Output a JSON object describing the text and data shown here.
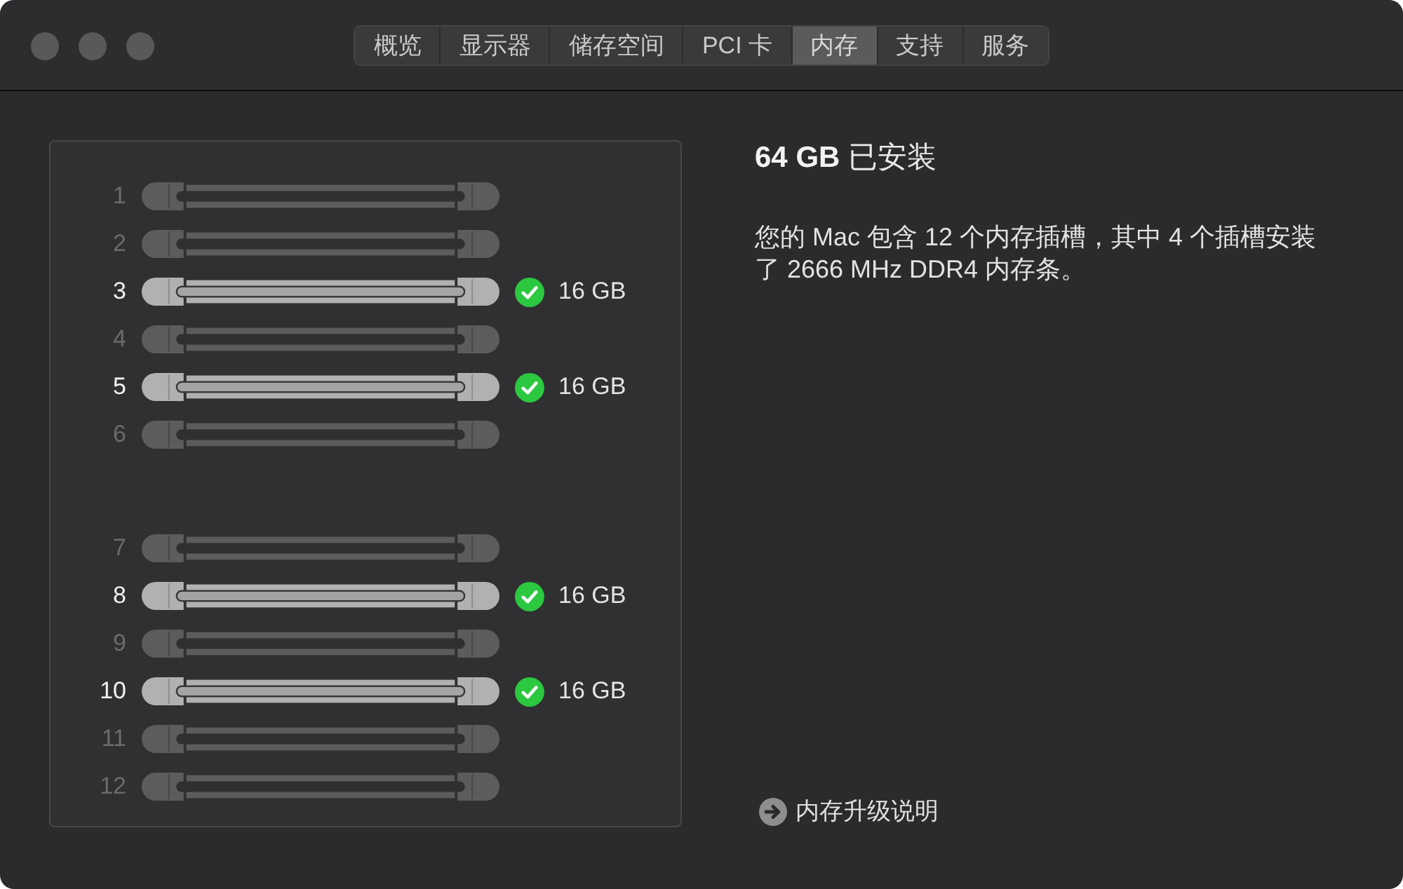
{
  "window": {
    "tabs": [
      {
        "label": "概览",
        "selected": false
      },
      {
        "label": "显示器",
        "selected": false
      },
      {
        "label": "储存空间",
        "selected": false
      },
      {
        "label": "PCI 卡",
        "selected": false
      },
      {
        "label": "内存",
        "selected": true
      },
      {
        "label": "支持",
        "selected": false
      },
      {
        "label": "服务",
        "selected": false
      }
    ]
  },
  "slot_groups": [
    {
      "slots": [
        {
          "number": "1",
          "installed": false
        },
        {
          "number": "2",
          "installed": false
        },
        {
          "number": "3",
          "installed": true,
          "capacity": "16 GB"
        },
        {
          "number": "4",
          "installed": false
        },
        {
          "number": "5",
          "installed": true,
          "capacity": "16 GB"
        },
        {
          "number": "6",
          "installed": false
        }
      ]
    },
    {
      "slots": [
        {
          "number": "7",
          "installed": false
        },
        {
          "number": "8",
          "installed": true,
          "capacity": "16 GB"
        },
        {
          "number": "9",
          "installed": false
        },
        {
          "number": "10",
          "installed": true,
          "capacity": "16 GB"
        },
        {
          "number": "11",
          "installed": false
        },
        {
          "number": "12",
          "installed": false
        }
      ]
    }
  ],
  "summary": {
    "title": "**64 GB** 已安装",
    "description": "您的 Mac 包含 12 个内存插槽，其中 4 个插槽安装了 2666 MHz DDR4 内存条。"
  },
  "link": {
    "label": "内存升级说明"
  }
}
